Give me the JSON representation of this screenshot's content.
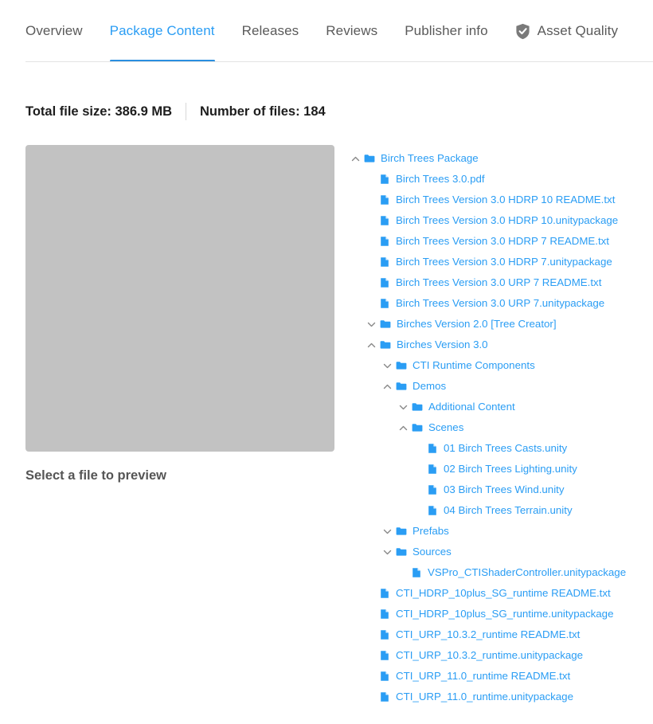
{
  "tabs": [
    {
      "label": "Overview",
      "active": false,
      "icon": null
    },
    {
      "label": "Package Content",
      "active": true,
      "icon": null
    },
    {
      "label": "Releases",
      "active": false,
      "icon": null
    },
    {
      "label": "Reviews",
      "active": false,
      "icon": null
    },
    {
      "label": "Publisher info",
      "active": false,
      "icon": null
    },
    {
      "label": "Asset Quality",
      "active": false,
      "icon": "shield-check-icon"
    }
  ],
  "summary": {
    "total_file_size": "Total file size: 386.9 MB",
    "number_of_files": "Number of files: 184"
  },
  "preview": {
    "caption": "Select a file to preview",
    "placeholder_color": "#c2c2c2"
  },
  "colors": {
    "accent": "#2a9df4",
    "tab_underline": "#2a8fe0",
    "tab_inactive": "#5a5a5a",
    "divider": "#e3e3e3",
    "shield": "#7a7a7a"
  },
  "tree": [
    {
      "name": "Birch Trees Package",
      "type": "folder",
      "depth": 0,
      "state": "expanded"
    },
    {
      "name": "Birch Trees 3.0.pdf",
      "type": "file",
      "depth": 1,
      "state": null
    },
    {
      "name": "Birch Trees Version 3.0 HDRP 10 README.txt",
      "type": "file",
      "depth": 1,
      "state": null
    },
    {
      "name": "Birch Trees Version 3.0 HDRP 10.unitypackage",
      "type": "file",
      "depth": 1,
      "state": null
    },
    {
      "name": "Birch Trees Version 3.0 HDRP 7 README.txt",
      "type": "file",
      "depth": 1,
      "state": null
    },
    {
      "name": "Birch Trees Version 3.0 HDRP 7.unitypackage",
      "type": "file",
      "depth": 1,
      "state": null
    },
    {
      "name": "Birch Trees Version 3.0 URP 7 README.txt",
      "type": "file",
      "depth": 1,
      "state": null
    },
    {
      "name": "Birch Trees Version 3.0 URP 7.unitypackage",
      "type": "file",
      "depth": 1,
      "state": null
    },
    {
      "name": "Birches Version 2.0 [Tree Creator]",
      "type": "folder",
      "depth": 1,
      "state": "collapsed"
    },
    {
      "name": "Birches Version 3.0",
      "type": "folder",
      "depth": 1,
      "state": "expanded"
    },
    {
      "name": "CTI Runtime Components",
      "type": "folder",
      "depth": 2,
      "state": "collapsed"
    },
    {
      "name": "Demos",
      "type": "folder",
      "depth": 2,
      "state": "expanded"
    },
    {
      "name": "Additional Content",
      "type": "folder",
      "depth": 3,
      "state": "collapsed"
    },
    {
      "name": "Scenes",
      "type": "folder",
      "depth": 3,
      "state": "expanded"
    },
    {
      "name": "01 Birch Trees Casts.unity",
      "type": "file",
      "depth": 4,
      "state": null
    },
    {
      "name": "02 Birch Trees Lighting.unity",
      "type": "file",
      "depth": 4,
      "state": null
    },
    {
      "name": "03 Birch Trees Wind.unity",
      "type": "file",
      "depth": 4,
      "state": null
    },
    {
      "name": "04 Birch Trees Terrain.unity",
      "type": "file",
      "depth": 4,
      "state": null
    },
    {
      "name": "Prefabs",
      "type": "folder",
      "depth": 2,
      "state": "collapsed"
    },
    {
      "name": "Sources",
      "type": "folder",
      "depth": 2,
      "state": "collapsed"
    },
    {
      "name": "VSPro_CTIShaderController.unitypackage",
      "type": "file",
      "depth": 3,
      "state": null
    },
    {
      "name": "CTI_HDRP_10plus_SG_runtime README.txt",
      "type": "file",
      "depth": 1,
      "state": null
    },
    {
      "name": "CTI_HDRP_10plus_SG_runtime.unitypackage",
      "type": "file",
      "depth": 1,
      "state": null
    },
    {
      "name": "CTI_URP_10.3.2_runtime README.txt",
      "type": "file",
      "depth": 1,
      "state": null
    },
    {
      "name": "CTI_URP_10.3.2_runtime.unitypackage",
      "type": "file",
      "depth": 1,
      "state": null
    },
    {
      "name": "CTI_URP_11.0_runtime README.txt",
      "type": "file",
      "depth": 1,
      "state": null
    },
    {
      "name": "CTI_URP_11.0_runtime.unitypackage",
      "type": "file",
      "depth": 1,
      "state": null
    }
  ]
}
